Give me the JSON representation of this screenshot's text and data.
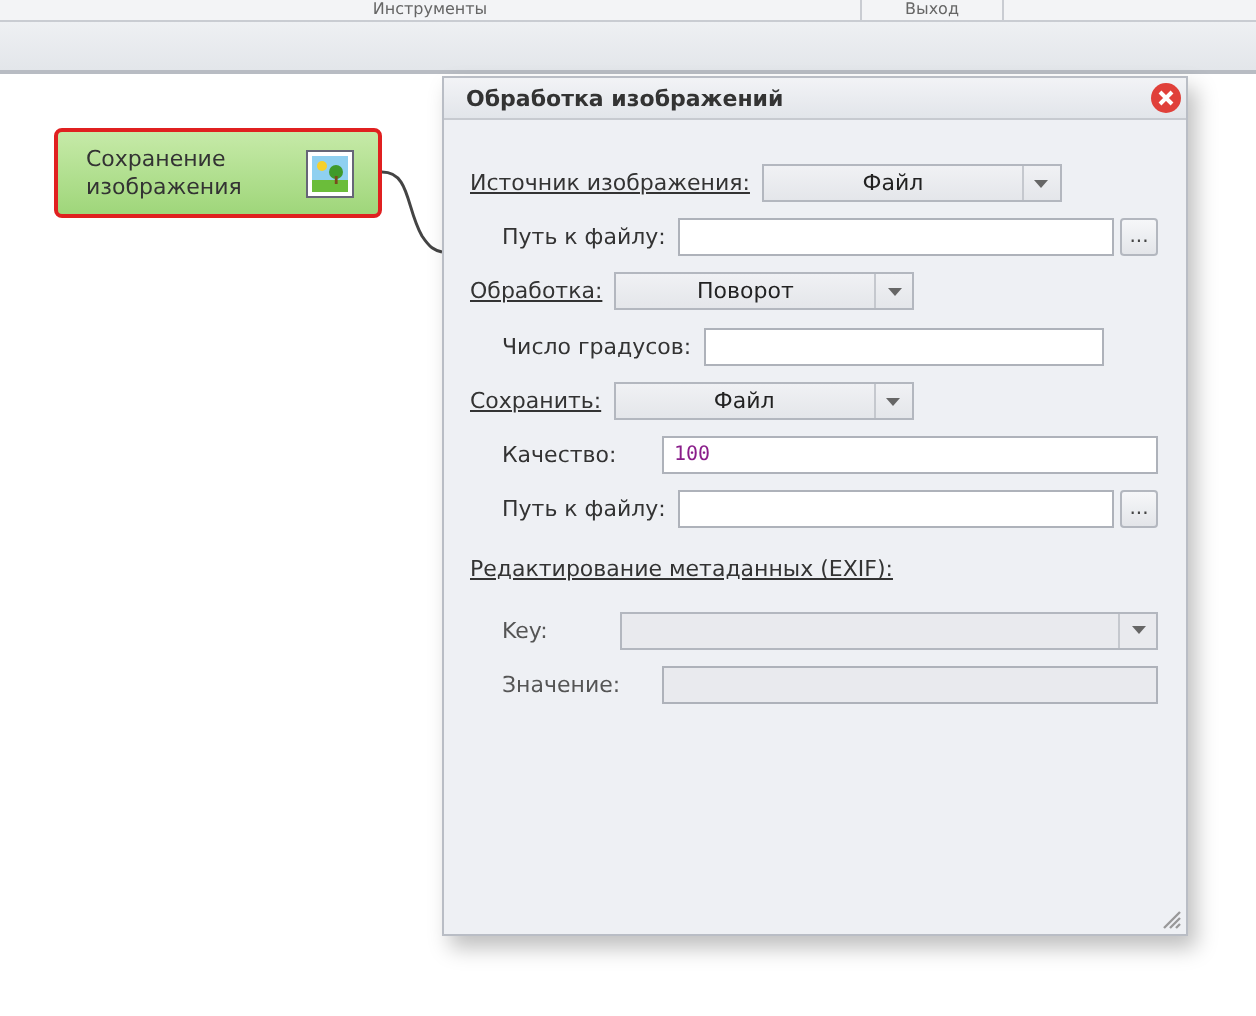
{
  "ribbon": {
    "groups": [
      {
        "label": "Инструменты"
      },
      {
        "label": "Выход"
      }
    ]
  },
  "canvas": {
    "node": {
      "title": "Сохранение изображения",
      "selected": true
    }
  },
  "dialog": {
    "title": "Обработка изображений",
    "rows": [
      {
        "kind": "choice",
        "label": "Источник изображения:",
        "value": "Файл",
        "disabled": false
      },
      {
        "kind": "path",
        "label": "Путь к файлу:",
        "button": "...",
        "disabled": false
      },
      {
        "kind": "choice",
        "label": "Обработка:",
        "value": "Поворот",
        "disabled": false
      },
      {
        "kind": "short",
        "label": "Число градусов:",
        "disabled": false
      },
      {
        "kind": "choice",
        "label": "Сохранить:",
        "value": "Файл",
        "disabled": false
      },
      {
        "kind": "field",
        "label": "Качество:",
        "value": "100",
        "disabled": false
      },
      {
        "kind": "path",
        "label": "Путь к файлу:",
        "button": "...",
        "disabled": false
      },
      {
        "kind": "section",
        "label": "Редактирование метаданных (EXIF):",
        "disabled": false
      },
      {
        "kind": "combo",
        "label": "Key:",
        "disabled": true
      },
      {
        "kind": "field",
        "label": "Значение:",
        "disabled": true
      }
    ]
  }
}
